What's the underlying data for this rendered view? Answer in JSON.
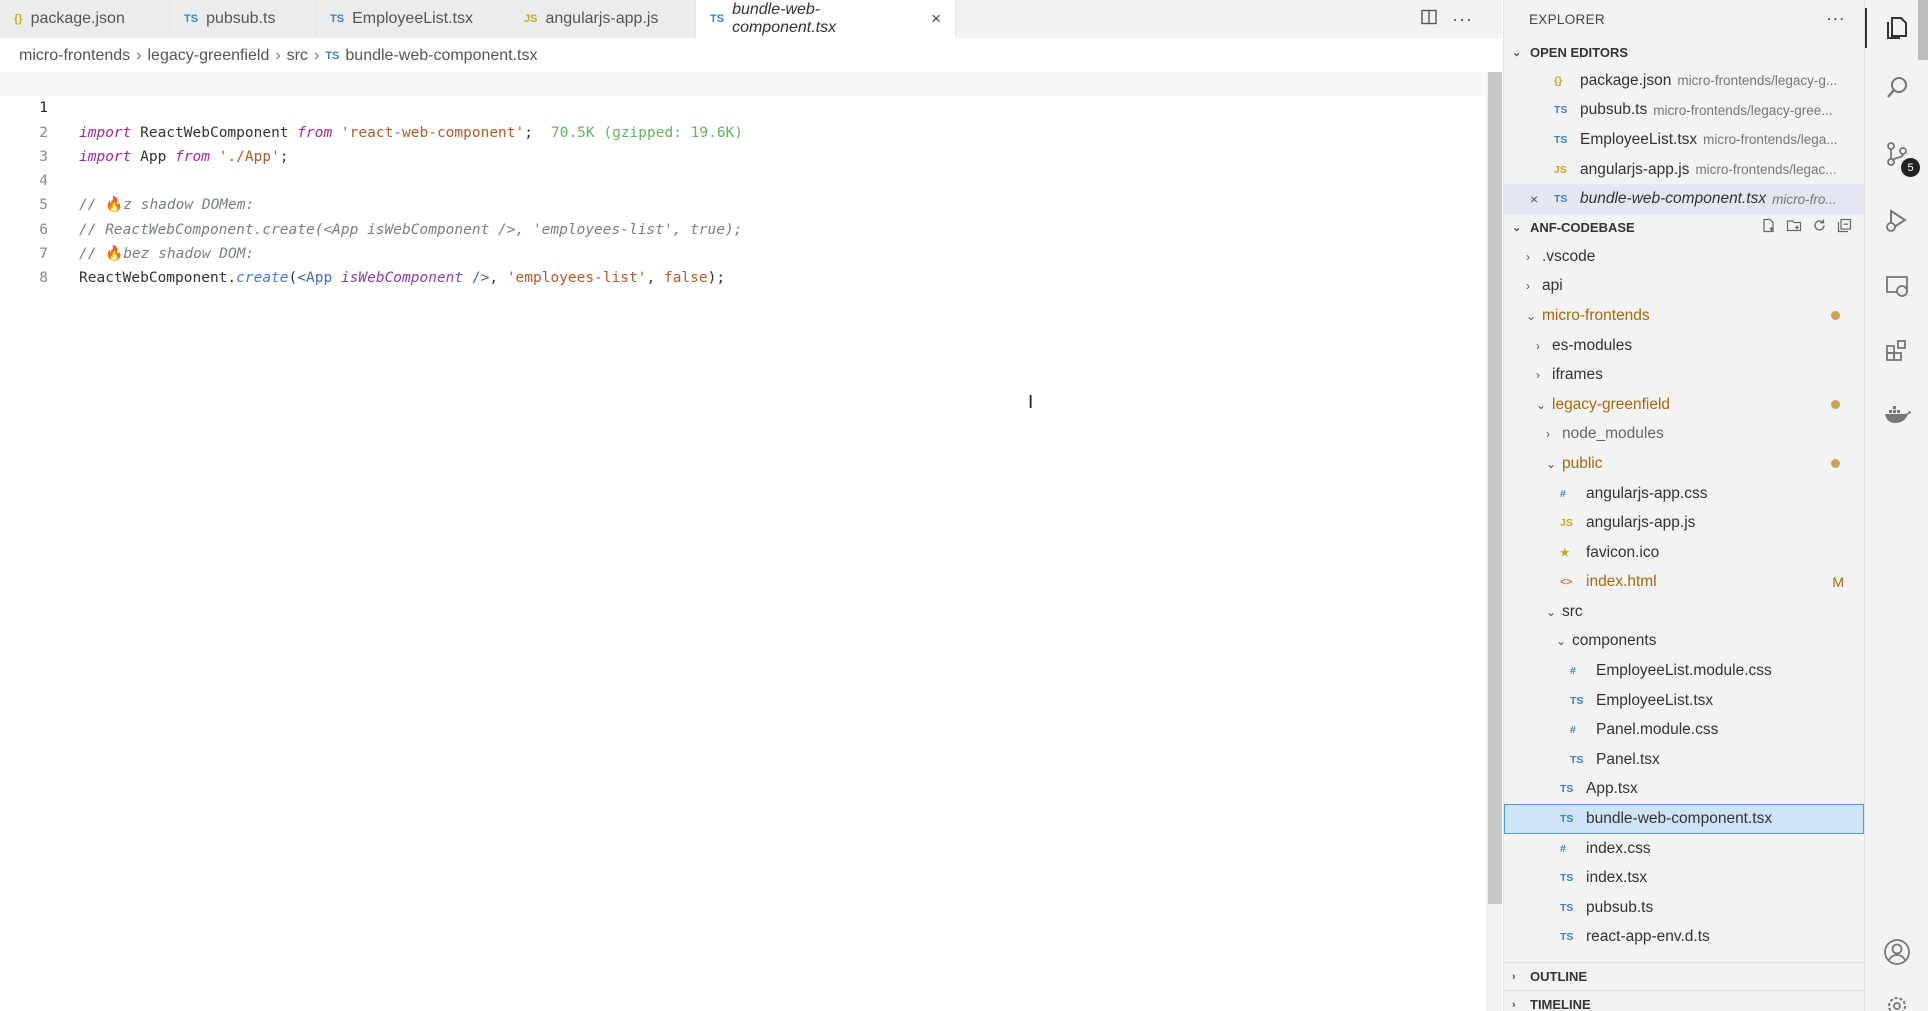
{
  "tabs": [
    {
      "icon": "{}",
      "icon_type": "json",
      "label": "package.json",
      "active": false
    },
    {
      "icon": "TS",
      "icon_type": "ts",
      "label": "pubsub.ts",
      "active": false
    },
    {
      "icon": "TS",
      "icon_type": "ts",
      "label": "EmployeeList.tsx",
      "active": false
    },
    {
      "icon": "JS",
      "icon_type": "js",
      "label": "angularjs-app.js",
      "active": false
    },
    {
      "icon": "TS",
      "icon_type": "ts",
      "label": "bundle-web-component.tsx",
      "active": true
    }
  ],
  "breadcrumb": {
    "parts": [
      "micro-frontends",
      "legacy-greenfield",
      "src"
    ],
    "file_icon": "TS",
    "file": "bundle-web-component.tsx"
  },
  "editor": {
    "line_numbers": [
      "1",
      "2",
      "3",
      "4",
      "5",
      "6",
      "7",
      "8"
    ],
    "current_line": 1,
    "line1": {
      "kw1": "import",
      "name": " ReactWebComponent ",
      "kw2": "from",
      "sp": " ",
      "str": "'react-web-component'",
      "end": ";",
      "inlay": "70.5K (gzipped: 19.6K)"
    },
    "line2": {
      "kw1": "import",
      "name": " App ",
      "kw2": "from",
      "sp": " ",
      "str": "'./App'",
      "end": ";"
    },
    "line4": {
      "comment_a": "// ",
      "emoji": "🔥",
      "comment_b": "z shadow DOMem:"
    },
    "line5": {
      "comment": "// ReactWebComponent.create(<App isWebComponent />, 'employees-list', true);"
    },
    "line6": {
      "comment_a": "// ",
      "emoji": "🔥",
      "comment_b": "bez shadow DOM:"
    },
    "line7": {
      "obj": "ReactWebComponent",
      "dot": ".",
      "fn": "create",
      "p1": "(",
      "tag": "<App",
      "sp": " ",
      "attr": "isWebComponent",
      "tagend": " />",
      "comma1": ", ",
      "str": "'employees-list'",
      "comma2": ", ",
      "bool": "false",
      "end": ");"
    }
  },
  "explorer": {
    "title": "EXPLORER",
    "open_editors": {
      "header": "OPEN EDITORS",
      "items": [
        {
          "icon": "{}",
          "icon_type": "json",
          "label": "package.json",
          "desc": "micro-frontends/legacy-g..."
        },
        {
          "icon": "TS",
          "icon_type": "ts",
          "label": "pubsub.ts",
          "desc": "micro-frontends/legacy-gree..."
        },
        {
          "icon": "TS",
          "icon_type": "ts",
          "label": "EmployeeList.tsx",
          "desc": "micro-frontends/lega..."
        },
        {
          "icon": "JS",
          "icon_type": "js",
          "label": "angularjs-app.js",
          "desc": "micro-frontends/legac..."
        },
        {
          "icon": "TS",
          "icon_type": "ts",
          "label": "bundle-web-component.tsx",
          "desc": "micro-fro...",
          "active": true,
          "close": "×"
        }
      ]
    },
    "project": {
      "header": "ANF-CODEBASE",
      "tree": [
        {
          "depth": 0,
          "chev": "›",
          "label": ".vscode"
        },
        {
          "depth": 0,
          "chev": "›",
          "label": "api"
        },
        {
          "depth": 0,
          "chev": "⌄",
          "label": "micro-frontends",
          "modified": true,
          "dot": true
        },
        {
          "depth": 1,
          "chev": "›",
          "label": "es-modules"
        },
        {
          "depth": 1,
          "chev": "›",
          "label": "iframes"
        },
        {
          "depth": 1,
          "chev": "⌄",
          "label": "legacy-greenfield",
          "modified": true,
          "dot": true
        },
        {
          "depth": 2,
          "chev": "›",
          "label": "node_modules",
          "ignored": true
        },
        {
          "depth": 2,
          "chev": "⌄",
          "label": "public",
          "modified": true,
          "dot": true
        },
        {
          "depth": 3,
          "icon": "#",
          "icon_type": "css",
          "label": "angularjs-app.css"
        },
        {
          "depth": 3,
          "icon": "JS",
          "icon_type": "js",
          "label": "angularjs-app.js"
        },
        {
          "depth": 3,
          "icon": "★",
          "icon_type": "star",
          "label": "favicon.ico"
        },
        {
          "depth": 3,
          "icon": "<>",
          "icon_type": "html",
          "label": "index.html",
          "modified": true,
          "badge": "M"
        },
        {
          "depth": 2,
          "chev": "⌄",
          "label": "src"
        },
        {
          "depth": 3,
          "chev": "⌄",
          "label": "components"
        },
        {
          "depth": 4,
          "icon": "#",
          "icon_type": "css",
          "label": "EmployeeList.module.css"
        },
        {
          "depth": 4,
          "icon": "TS",
          "icon_type": "ts",
          "label": "EmployeeList.tsx"
        },
        {
          "depth": 4,
          "icon": "#",
          "icon_type": "css",
          "label": "Panel.module.css"
        },
        {
          "depth": 4,
          "icon": "TS",
          "icon_type": "ts",
          "label": "Panel.tsx"
        },
        {
          "depth": 3,
          "icon": "TS",
          "icon_type": "ts",
          "label": "App.tsx"
        },
        {
          "depth": 3,
          "icon": "TS",
          "icon_type": "ts",
          "label": "bundle-web-component.tsx",
          "selected": true
        },
        {
          "depth": 3,
          "icon": "#",
          "icon_type": "css",
          "label": "index.css"
        },
        {
          "depth": 3,
          "icon": "TS",
          "icon_type": "ts",
          "label": "index.tsx"
        },
        {
          "depth": 3,
          "icon": "TS",
          "icon_type": "ts",
          "label": "pubsub.ts"
        },
        {
          "depth": 3,
          "icon": "TS",
          "icon_type": "ts",
          "label": "react-app-env.d.ts"
        }
      ]
    },
    "outline": "OUTLINE",
    "timeline": "TIMELINE"
  },
  "activity_bar": {
    "source_control_badge": "5",
    "icons": [
      "files-icon",
      "search-icon",
      "source-control-icon",
      "run-debug-icon",
      "remote-explorer-icon",
      "extensions-icon",
      "docker-icon",
      "account-icon"
    ]
  }
}
